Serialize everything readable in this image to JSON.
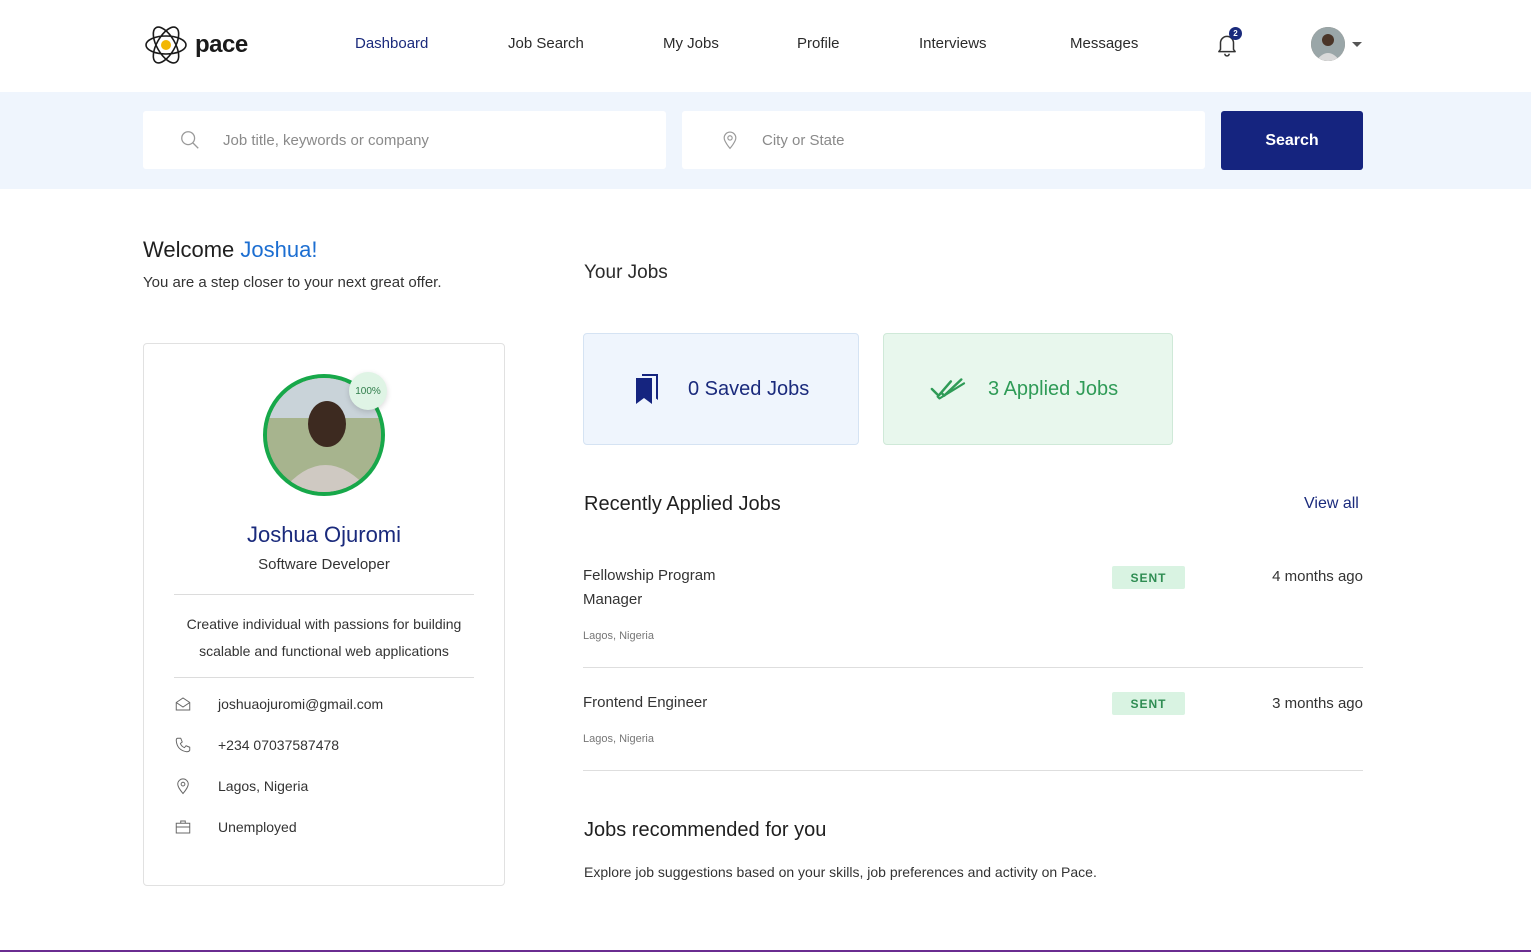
{
  "brand": {
    "name": "pace"
  },
  "nav": {
    "items": [
      {
        "label": "Dashboard",
        "active": true
      },
      {
        "label": "Job Search",
        "active": false
      },
      {
        "label": "My Jobs",
        "active": false
      },
      {
        "label": "Profile",
        "active": false
      },
      {
        "label": "Interviews",
        "active": false
      },
      {
        "label": "Messages",
        "active": false
      }
    ],
    "notification_count": "2"
  },
  "search": {
    "keyword_placeholder": "Job title, keywords or company",
    "location_placeholder": "City or State",
    "button_label": "Search"
  },
  "welcome": {
    "greeting": "Welcome",
    "name": "Joshua!",
    "subtitle": "You are a step closer to your next great offer."
  },
  "profile": {
    "completion": "100%",
    "full_name": "Joshua Ojuromi",
    "role": "Software Developer",
    "bio": "Creative individual with passions for building scalable and functional web applications",
    "email": "joshuaojuromi@gmail.com",
    "phone": "+234 07037587478",
    "location": "Lagos, Nigeria",
    "employment": "Unemployed"
  },
  "your_jobs": {
    "title": "Your Jobs",
    "saved_label": "0 Saved Jobs",
    "applied_label": "3 Applied Jobs"
  },
  "recent": {
    "title": "Recently Applied Jobs",
    "view_all": "View all",
    "jobs": [
      {
        "title": "Fellowship Program Manager",
        "location": "Lagos, Nigeria",
        "status": "SENT",
        "time": "4 months ago"
      },
      {
        "title": "Frontend Engineer",
        "location": "Lagos, Nigeria",
        "status": "SENT",
        "time": "3 months ago"
      }
    ]
  },
  "recommended": {
    "title": "Jobs recommended for you",
    "subtitle": "Explore job suggestions based on your skills, job preferences and activity on Pace."
  },
  "colors": {
    "primary": "#15247f",
    "accent_blue": "#1c6ed1",
    "success": "#17a84a",
    "band": "#eff5fd"
  }
}
